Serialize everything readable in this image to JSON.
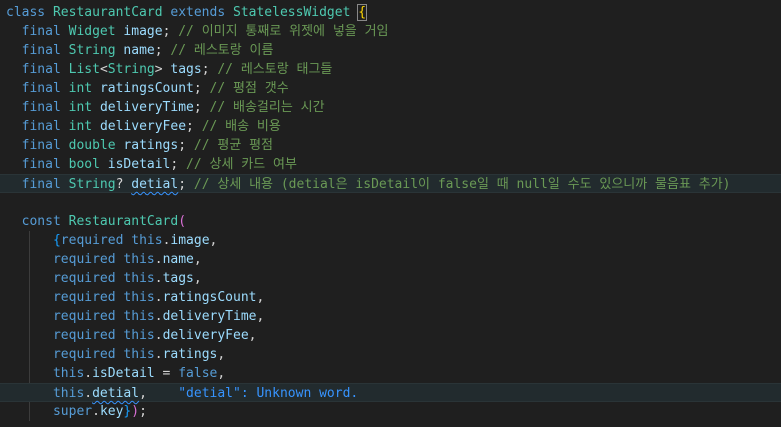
{
  "editor": {
    "colors": {
      "background": "#1f1f1f",
      "keyword": "#569cd6",
      "type": "#4ec9b0",
      "identifier": "#9cdcfe",
      "comment": "#6a9955",
      "string": "#ce9178",
      "diagnostic": "#3794ff"
    },
    "lines": [
      {
        "tokens": [
          [
            "kw",
            "class"
          ],
          [
            "pn",
            " "
          ],
          [
            "ty",
            "RestaurantCard"
          ],
          [
            "pn",
            " "
          ],
          [
            "kw",
            "extends"
          ],
          [
            "pn",
            " "
          ],
          [
            "ty",
            "StatelessWidget"
          ],
          [
            "pn",
            " "
          ],
          [
            "br1",
            "{"
          ]
        ]
      },
      {
        "tokens": [
          [
            "pn",
            "  "
          ],
          [
            "kw",
            "final"
          ],
          [
            "pn",
            " "
          ],
          [
            "ty",
            "Widget"
          ],
          [
            "pn",
            " "
          ],
          [
            "id",
            "image"
          ],
          [
            "pn",
            "; "
          ],
          [
            "cm",
            "// 이미지 통째로 위젯에 넣을 거임"
          ]
        ]
      },
      {
        "tokens": [
          [
            "pn",
            "  "
          ],
          [
            "kw",
            "final"
          ],
          [
            "pn",
            " "
          ],
          [
            "ty",
            "String"
          ],
          [
            "pn",
            " "
          ],
          [
            "id",
            "name"
          ],
          [
            "pn",
            "; "
          ],
          [
            "cm",
            "// 레스토랑 이름"
          ]
        ]
      },
      {
        "tokens": [
          [
            "pn",
            "  "
          ],
          [
            "kw",
            "final"
          ],
          [
            "pn",
            " "
          ],
          [
            "ty",
            "List"
          ],
          [
            "pn",
            "<"
          ],
          [
            "ty",
            "String"
          ],
          [
            "pn",
            "> "
          ],
          [
            "id",
            "tags"
          ],
          [
            "pn",
            "; "
          ],
          [
            "cm",
            "// 레스토랑 태그들"
          ]
        ]
      },
      {
        "tokens": [
          [
            "pn",
            "  "
          ],
          [
            "kw",
            "final"
          ],
          [
            "pn",
            " "
          ],
          [
            "ty",
            "int"
          ],
          [
            "pn",
            " "
          ],
          [
            "id",
            "ratingsCount"
          ],
          [
            "pn",
            "; "
          ],
          [
            "cm",
            "// 평점 갯수"
          ]
        ]
      },
      {
        "tokens": [
          [
            "pn",
            "  "
          ],
          [
            "kw",
            "final"
          ],
          [
            "pn",
            " "
          ],
          [
            "ty",
            "int"
          ],
          [
            "pn",
            " "
          ],
          [
            "id",
            "deliveryTime"
          ],
          [
            "pn",
            "; "
          ],
          [
            "cm",
            "// 배송걸리는 시간"
          ]
        ]
      },
      {
        "tokens": [
          [
            "pn",
            "  "
          ],
          [
            "kw",
            "final"
          ],
          [
            "pn",
            " "
          ],
          [
            "ty",
            "int"
          ],
          [
            "pn",
            " "
          ],
          [
            "id",
            "deliveryFee"
          ],
          [
            "pn",
            "; "
          ],
          [
            "cm",
            "// 배송 비용"
          ]
        ]
      },
      {
        "tokens": [
          [
            "pn",
            "  "
          ],
          [
            "kw",
            "final"
          ],
          [
            "pn",
            " "
          ],
          [
            "ty",
            "double"
          ],
          [
            "pn",
            " "
          ],
          [
            "id",
            "ratings"
          ],
          [
            "pn",
            "; "
          ],
          [
            "cm",
            "// 평균 평점"
          ]
        ]
      },
      {
        "tokens": [
          [
            "pn",
            "  "
          ],
          [
            "kw",
            "final"
          ],
          [
            "pn",
            " "
          ],
          [
            "ty",
            "bool"
          ],
          [
            "pn",
            " "
          ],
          [
            "id",
            "isDetail"
          ],
          [
            "pn",
            "; "
          ],
          [
            "cm",
            "// 상세 카드 여부"
          ]
        ]
      },
      {
        "active": true,
        "tokens": [
          [
            "pn",
            "  "
          ],
          [
            "kw",
            "final"
          ],
          [
            "pn",
            " "
          ],
          [
            "ty",
            "String"
          ],
          [
            "pn",
            "? "
          ],
          [
            "id squig",
            "detial"
          ],
          [
            "pn",
            "; "
          ],
          [
            "cm",
            "// 상세 내용 (detial은 isDetail이 false일 때 null일 수도 있으니까 물음표 추가)"
          ]
        ]
      },
      {
        "tokens": []
      },
      {
        "tokens": [
          [
            "pn",
            "  "
          ],
          [
            "kw",
            "const"
          ],
          [
            "pn",
            " "
          ],
          [
            "ty",
            "RestaurantCard"
          ],
          [
            "br2",
            "("
          ]
        ]
      },
      {
        "tokens": [
          [
            "pn",
            "      "
          ],
          [
            "br3",
            "{"
          ],
          [
            "kw",
            "required"
          ],
          [
            "pn",
            " "
          ],
          [
            "kw",
            "this"
          ],
          [
            "pn",
            "."
          ],
          [
            "id",
            "image"
          ],
          [
            "pn",
            ","
          ]
        ]
      },
      {
        "tokens": [
          [
            "pn",
            "      "
          ],
          [
            "kw",
            "required"
          ],
          [
            "pn",
            " "
          ],
          [
            "kw",
            "this"
          ],
          [
            "pn",
            "."
          ],
          [
            "id",
            "name"
          ],
          [
            "pn",
            ","
          ]
        ]
      },
      {
        "tokens": [
          [
            "pn",
            "      "
          ],
          [
            "kw",
            "required"
          ],
          [
            "pn",
            " "
          ],
          [
            "kw",
            "this"
          ],
          [
            "pn",
            "."
          ],
          [
            "id",
            "tags"
          ],
          [
            "pn",
            ","
          ]
        ]
      },
      {
        "tokens": [
          [
            "pn",
            "      "
          ],
          [
            "kw",
            "required"
          ],
          [
            "pn",
            " "
          ],
          [
            "kw",
            "this"
          ],
          [
            "pn",
            "."
          ],
          [
            "id",
            "ratingsCount"
          ],
          [
            "pn",
            ","
          ]
        ]
      },
      {
        "tokens": [
          [
            "pn",
            "      "
          ],
          [
            "kw",
            "required"
          ],
          [
            "pn",
            " "
          ],
          [
            "kw",
            "this"
          ],
          [
            "pn",
            "."
          ],
          [
            "id",
            "deliveryTime"
          ],
          [
            "pn",
            ","
          ]
        ]
      },
      {
        "tokens": [
          [
            "pn",
            "      "
          ],
          [
            "kw",
            "required"
          ],
          [
            "pn",
            " "
          ],
          [
            "kw",
            "this"
          ],
          [
            "pn",
            "."
          ],
          [
            "id",
            "deliveryFee"
          ],
          [
            "pn",
            ","
          ]
        ]
      },
      {
        "tokens": [
          [
            "pn",
            "      "
          ],
          [
            "kw",
            "required"
          ],
          [
            "pn",
            " "
          ],
          [
            "kw",
            "this"
          ],
          [
            "pn",
            "."
          ],
          [
            "id",
            "ratings"
          ],
          [
            "pn",
            ","
          ]
        ]
      },
      {
        "tokens": [
          [
            "pn",
            "      "
          ],
          [
            "kw",
            "this"
          ],
          [
            "pn",
            "."
          ],
          [
            "id",
            "isDetail"
          ],
          [
            "pn",
            " = "
          ],
          [
            "kw",
            "false"
          ],
          [
            "pn",
            ","
          ]
        ]
      },
      {
        "active": true,
        "tokens": [
          [
            "pn",
            "      "
          ],
          [
            "kw",
            "this"
          ],
          [
            "pn",
            "."
          ],
          [
            "id squig",
            "detial"
          ],
          [
            "pn",
            ",    "
          ],
          [
            "hint",
            "\"detial\": Unknown word."
          ]
        ]
      },
      {
        "tokens": [
          [
            "pn",
            "      "
          ],
          [
            "kw",
            "super"
          ],
          [
            "pn",
            "."
          ],
          [
            "id",
            "key"
          ],
          [
            "br3",
            "}"
          ],
          [
            "br2",
            ")"
          ],
          [
            "pn",
            ";"
          ]
        ]
      }
    ]
  }
}
